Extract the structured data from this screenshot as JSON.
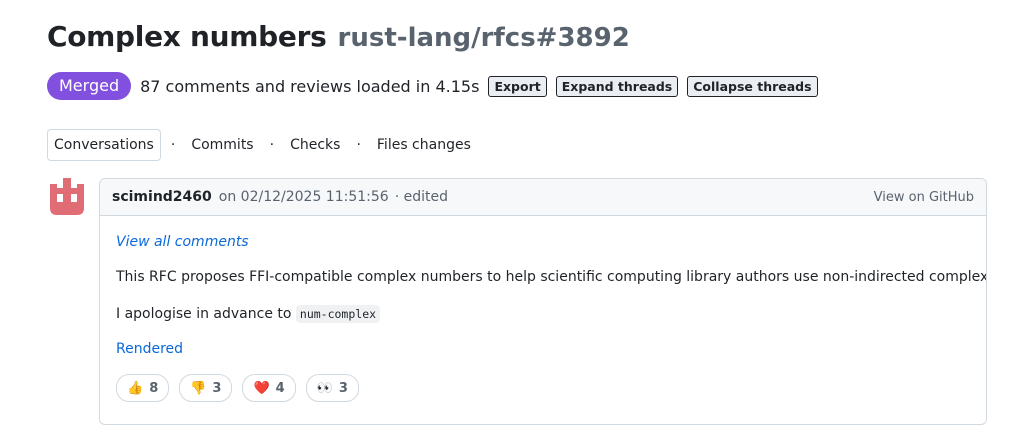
{
  "header": {
    "title": "Complex numbers",
    "repo_ref": "rust-lang/rfcs#3892"
  },
  "status": {
    "badge": "Merged",
    "loaded_text": "87 comments and reviews loaded in 4.15s",
    "buttons": {
      "export": "Export",
      "expand": "Expand threads",
      "collapse": "Collapse threads"
    }
  },
  "tabs": [
    {
      "label": "Conversations",
      "active": true
    },
    {
      "label": "Commits"
    },
    {
      "label": "Checks"
    },
    {
      "label": "Files changes"
    }
  ],
  "separator": "·",
  "comment": {
    "author": "scimind2460",
    "timestamp": "on 02/12/2025 11:51:56",
    "edited": "· edited",
    "view_on_github": "View on GitHub",
    "view_all": "View all comments",
    "paragraph1": "This RFC proposes FFI-compatible complex numbers to help scientific computing library authors use non-indirected complexes.",
    "paragraph2_prefix": "I apologise in advance to",
    "paragraph2_code": "num-complex",
    "rendered_link": "Rendered",
    "reactions": [
      {
        "emoji": "👍",
        "count": "8"
      },
      {
        "emoji": "👎",
        "count": "3"
      },
      {
        "emoji": "❤️",
        "count": "4"
      },
      {
        "emoji": "👀",
        "count": "3"
      }
    ]
  },
  "colors": {
    "merged": "#8250df",
    "link": "#0969da",
    "avatar": "#e06c75"
  }
}
